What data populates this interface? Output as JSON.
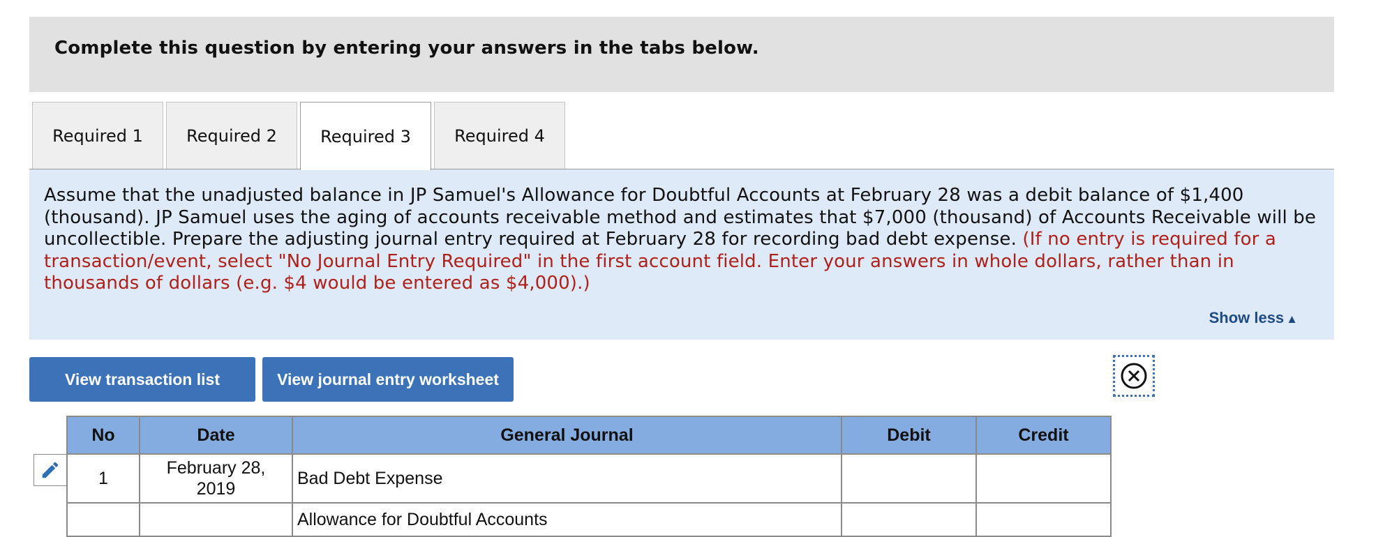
{
  "header": {
    "title": "Complete this question by entering your answers in the tabs below."
  },
  "tabs": [
    {
      "label": "Required 1",
      "active": false
    },
    {
      "label": "Required 2",
      "active": false
    },
    {
      "label": "Required 3",
      "active": true
    },
    {
      "label": "Required 4",
      "active": false
    }
  ],
  "question": {
    "text": "Assume that the unadjusted balance in JP Samuel's Allowance for Doubtful Accounts at February 28 was a debit balance of $1,400 (thousand). JP Samuel uses the aging of accounts receivable method and estimates that $7,000 (thousand) of Accounts Receivable will be uncollectible. Prepare the adjusting journal entry required at February 28 for recording bad debt expense.",
    "note": "(If no entry is required for a transaction/event, select \"No Journal Entry Required\" in the first account field. Enter your answers in whole dollars, rather than in thousands of dollars (e.g. $4 would be entered as $4,000).)",
    "show_less_label": "Show less",
    "show_less_arrow": "▲"
  },
  "buttons": {
    "view_transaction_list": "View transaction list",
    "view_journal_entry_worksheet": "View journal entry worksheet"
  },
  "journal": {
    "headers": {
      "no": "No",
      "date": "Date",
      "general_journal": "General Journal",
      "debit": "Debit",
      "credit": "Credit"
    },
    "rows": [
      {
        "no": "1",
        "date_line1": "February 28,",
        "date_line2": "2019",
        "account": "Bad Debt Expense",
        "debit": "",
        "credit": ""
      },
      {
        "no": "",
        "date_line1": "",
        "date_line2": "",
        "account": "Allowance for Doubtful Accounts",
        "debit": "",
        "credit": ""
      }
    ]
  },
  "colors": {
    "header_bg": "#e1e1e1",
    "question_bg": "#dfeaf8",
    "note_red": "#b0201a",
    "link_blue": "#1f4b85",
    "button_blue": "#3c72b8",
    "table_header_bg": "#85ace0"
  },
  "icons": {
    "close": "close-circle-icon",
    "edit": "pencil-icon",
    "show_less": "triangle-up-icon"
  }
}
